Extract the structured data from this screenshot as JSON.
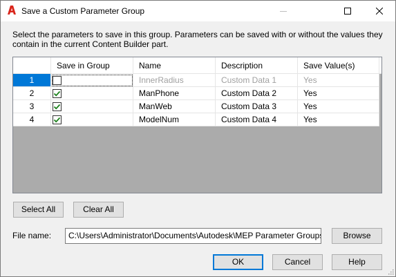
{
  "window": {
    "title": "Save a Custom Parameter Group",
    "icon": "autocad-a-icon",
    "accent": "#0078d7"
  },
  "instructions": "Select the parameters to save in this group. Parameters can be saved with or without the values they contain in the current Content Builder part.",
  "grid": {
    "columns": [
      "",
      "Save in Group",
      "Name",
      "Description",
      "Save Value(s)"
    ],
    "rows": [
      {
        "num": "1",
        "save": false,
        "name": "InnerRadius",
        "description": "Custom Data 1",
        "save_values": "Yes",
        "disabled": true,
        "selected": true
      },
      {
        "num": "2",
        "save": true,
        "name": "ManPhone",
        "description": "Custom Data 2",
        "save_values": "Yes",
        "disabled": false,
        "selected": false
      },
      {
        "num": "3",
        "save": true,
        "name": "ManWeb",
        "description": "Custom Data 3",
        "save_values": "Yes",
        "disabled": false,
        "selected": false
      },
      {
        "num": "4",
        "save": true,
        "name": "ModelNum",
        "description": "Custom Data 4",
        "save_values": "Yes",
        "disabled": false,
        "selected": false
      }
    ]
  },
  "buttons": {
    "select_all": "Select All",
    "clear_all": "Clear All",
    "browse": "Browse",
    "ok": "OK",
    "cancel": "Cancel",
    "help": "Help"
  },
  "file": {
    "label": "File name:",
    "value": "C:\\Users\\Administrator\\Documents\\Autodesk\\MEP Parameter Groups\\group"
  }
}
